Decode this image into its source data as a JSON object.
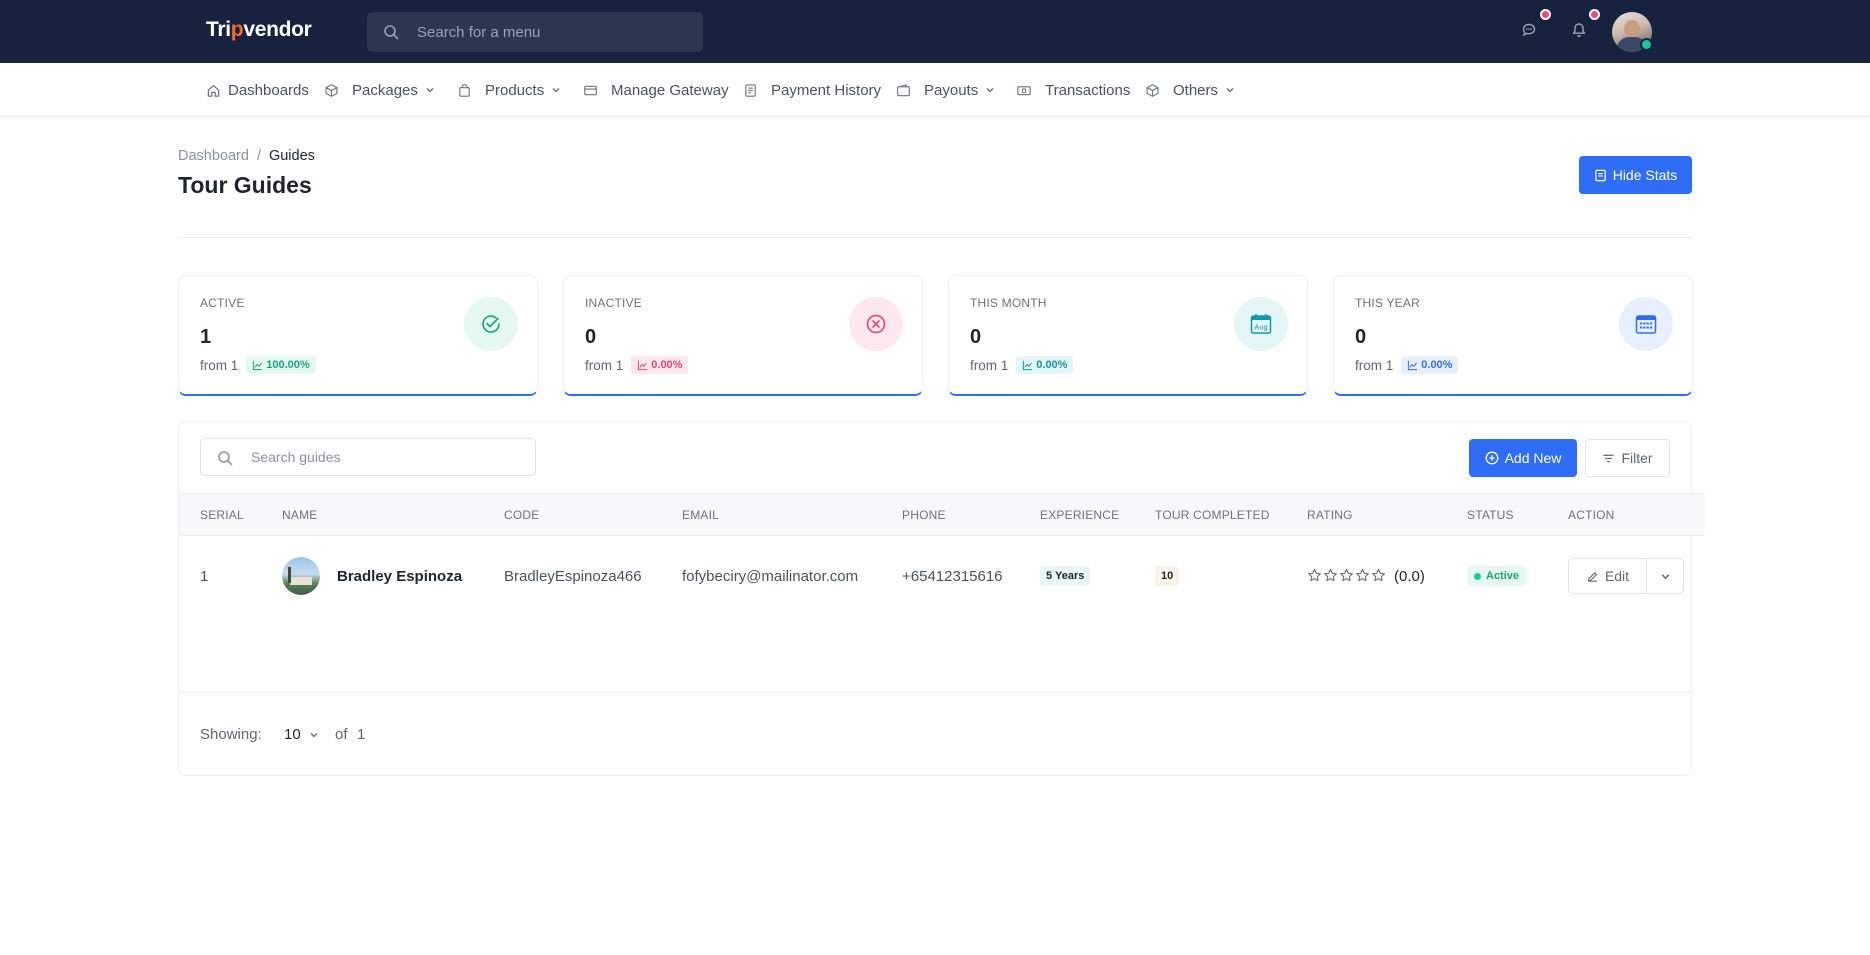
{
  "app": {
    "logo_pre": "Tri",
    "logo_dot": "p",
    "logo_post": "vendor",
    "search_placeholder": "Search for a menu"
  },
  "nav": {
    "items": [
      {
        "label": "Dashboards",
        "icon": "home-icon"
      },
      {
        "label": "Packages",
        "icon": "box-icon"
      },
      {
        "label": "Products",
        "icon": "bag-icon"
      },
      {
        "label": "Manage Gateway",
        "icon": "card-icon"
      },
      {
        "label": "Payment History",
        "icon": "receipt-icon"
      },
      {
        "label": "Payouts",
        "icon": "wallet-icon"
      },
      {
        "label": "Transactions",
        "icon": "cash-icon"
      },
      {
        "label": "Others",
        "icon": "box-icon"
      }
    ]
  },
  "header": {
    "breadcrumb_root": "Dashboard",
    "breadcrumb_sep": "/",
    "breadcrumb_current": "Guides",
    "title": "Tour Guides",
    "hide_stats_label": "Hide Stats"
  },
  "stats": [
    {
      "label": "ACTIVE",
      "value": "1",
      "from": "from 1",
      "change": "100.00%",
      "color": "#16a37c"
    },
    {
      "label": "INACTIVE",
      "value": "0",
      "from": "from 1",
      "change": "0.00%",
      "color": "#e0466c"
    },
    {
      "label": "THIS MONTH",
      "value": "0",
      "from": "from 1",
      "change": "0.00%",
      "color": "#1298a7",
      "icon_text": "Aug"
    },
    {
      "label": "THIS YEAR",
      "value": "0",
      "from": "from 1",
      "change": "0.00%",
      "color": "#2f6df6"
    }
  ],
  "table": {
    "search_placeholder": "Search guides",
    "add_new_label": "Add New",
    "filter_label": "Filter",
    "columns": [
      "SERIAL",
      "NAME",
      "CODE",
      "EMAIL",
      "PHONE",
      "EXPERIENCE",
      "TOUR COMPLETED",
      "RATING",
      "STATUS",
      "ACTION"
    ],
    "rows": [
      {
        "serial": "1",
        "name": "Bradley Espinoza",
        "code": "BradleyEspinoza466",
        "email": "fofybeciry@mailinator.com",
        "phone": "+65412315616",
        "experience": "5 Years",
        "tours": "10",
        "rating": 0,
        "rating_text": "(0.0)",
        "status": "Active",
        "edit_label": "Edit"
      }
    ]
  },
  "footer": {
    "showing_label": "Showing:",
    "per_page": "10",
    "of_label": "of",
    "total": "1"
  },
  "colors": {
    "primary": "#2f6df6",
    "topbar": "#17223f",
    "success": "#16a37c",
    "danger": "#e0466c"
  }
}
